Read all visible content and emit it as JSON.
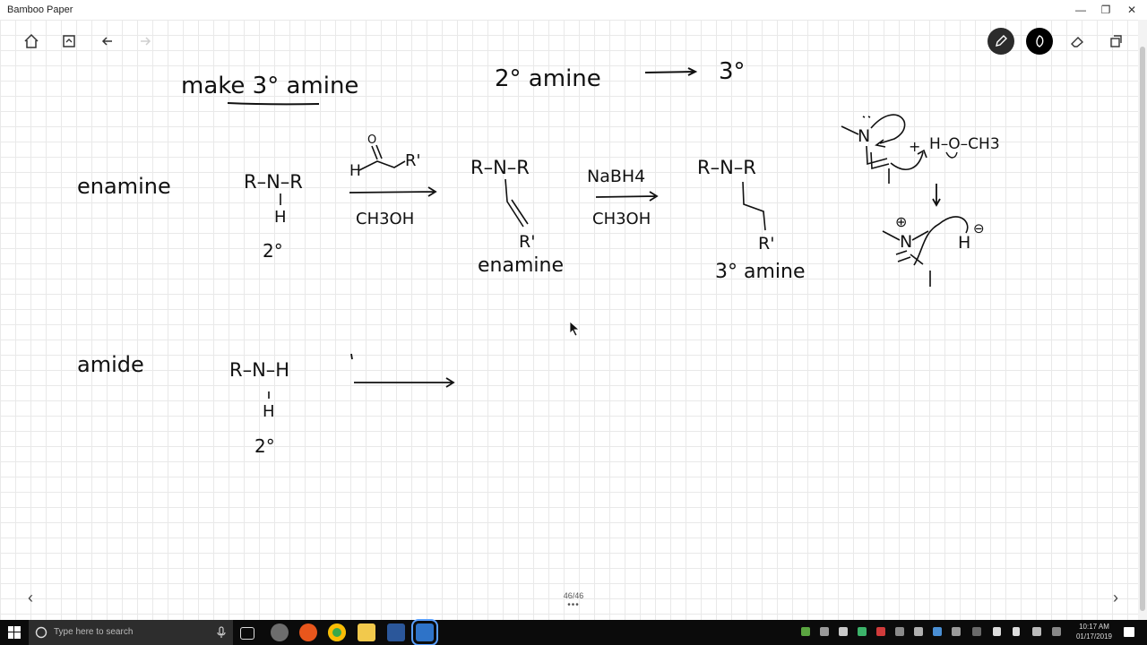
{
  "window": {
    "title": "Bamboo Paper",
    "minimize": "—",
    "restore": "❐",
    "close": "✕"
  },
  "toolbar": {
    "left": [
      "home-icon",
      "notebook-icon",
      "undo-icon",
      "redo-icon"
    ],
    "right": [
      "pen-icon",
      "ink-color-icon",
      "eraser-icon",
      "copy-icon"
    ]
  },
  "notes": {
    "heading": "make 3° amine",
    "summary_left": "2° amine",
    "summary_right": "3°",
    "enamine_label": "enamine",
    "sec_amine_top": "R–N–R",
    "sec_amine_h": "H",
    "sec_amine_deg": "2°",
    "aldehyde_o": "O",
    "aldehyde_h": "H",
    "aldehyde_r": "R'",
    "reagent1": "CH3OH",
    "enamine_top": "R–N–R",
    "enamine_r": "R'",
    "enamine_caption": "enamine",
    "reagent2_top": "NaBH4",
    "reagent2_bottom": "CH3OH",
    "product_top": "R–N–R",
    "product_r": "R'",
    "product_caption": "3° amine",
    "mech_plus": "+",
    "mech_acid": "H–O–CH3",
    "mech_n": "N",
    "mech_charge_pos": "⊕",
    "mech_h": "H",
    "mech_charge_neg": "⊖",
    "amide_label": "amide",
    "amide_top": "R–N–H",
    "amide_h": "H",
    "amide_deg": "2°"
  },
  "footer": {
    "page": "46/46",
    "dots": "•••",
    "prev": "‹",
    "next": "›"
  },
  "taskbar": {
    "search_placeholder": "Type here to search",
    "time": "10:17 AM",
    "date": "01/17/2019"
  }
}
